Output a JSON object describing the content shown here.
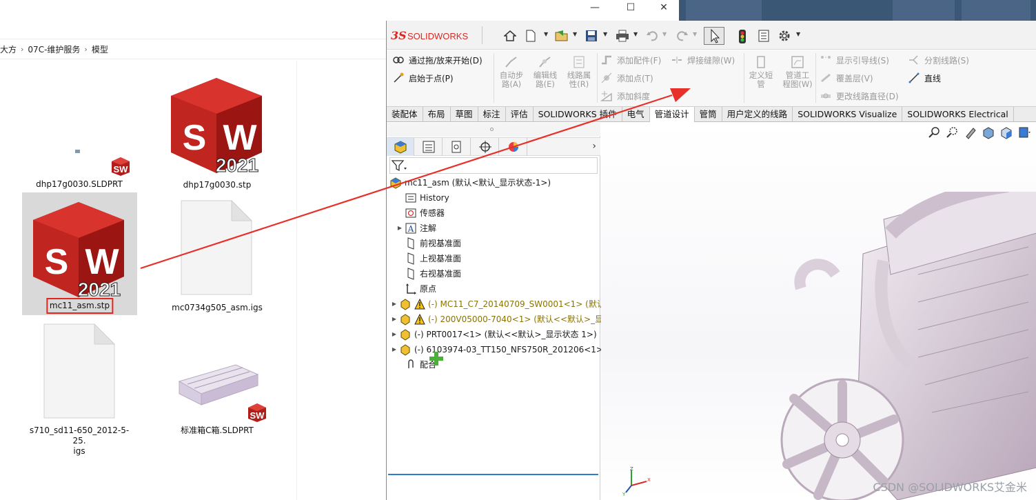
{
  "explorer": {
    "window_buttons": [
      "—",
      "☐",
      "✕"
    ],
    "breadcrumb": [
      "大方",
      "07C-维护服务",
      "模型"
    ],
    "files": [
      {
        "name": "dhp17g0030.SLDPRT"
      },
      {
        "name": "dhp17g0030.stp"
      },
      {
        "name": "mc11_asm.stp"
      },
      {
        "name": "mc0734g505_asm.igs"
      },
      {
        "name": "s710_sd11-650_2012-5-25.\nigs"
      },
      {
        "name": "标准箱C箱.SLDPRT"
      }
    ],
    "sw_icon_year": "2021",
    "sw_icon_letters": "SW"
  },
  "solidworks": {
    "logo_ds": "3S",
    "logo_solid": "SOLID",
    "logo_works": "WORKS",
    "command_manager": {
      "start_drag": "通过拖/放来开始(D)",
      "start_point": "启始于点(P)",
      "auto_route": "自动步\n路(A)",
      "edit_route": "编辑线\n路(E)",
      "route_props": "线路属\n性(R)",
      "add_fitting": "添加配件(F)",
      "add_point": "添加点(T)",
      "add_slope": "添加斜度",
      "weld_gap": "焊接缝隙(W)",
      "define_stub": "定义短\n管",
      "pipe_drawing": "管道工\n程图(W)",
      "show_guides": "显示引导线(S)",
      "cover_layer": "覆盖层(V)",
      "change_diameter": "更改线路直径(D)",
      "split_route": "分割线路(S)",
      "line": "直线"
    },
    "tabs": [
      "装配体",
      "布局",
      "草图",
      "标注",
      "评估",
      "SOLIDWORKS 插件",
      "电气",
      "管道设计",
      "管筒",
      "用户定义的线路",
      "SOLIDWORKS Visualize",
      "SOLIDWORKS Electrical"
    ],
    "active_tab_index": 7,
    "tree": {
      "root": "mc11_asm  (默认<默认_显示状态-1>)",
      "items": [
        {
          "label": "History",
          "warn": false
        },
        {
          "label": "传感器",
          "warn": false
        },
        {
          "label": "注解",
          "warn": false
        },
        {
          "label": "前视基准面",
          "warn": false
        },
        {
          "label": "上视基准面",
          "warn": false
        },
        {
          "label": "右视基准面",
          "warn": false
        },
        {
          "label": "原点",
          "warn": false
        },
        {
          "label": "(-) MC11_C7_20140709_SW0001<1> (默认",
          "warn": true
        },
        {
          "label": "(-) 200V05000-7040<1> (默认<<默认>_显",
          "warn": true
        },
        {
          "label": "(-) PRT0017<1> (默认<<默认>_显示状态 1>)",
          "warn": false
        },
        {
          "label": "(-) 6103974-03_TT150_NFS750R_201206<1>",
          "warn": false
        },
        {
          "label": "配合",
          "warn": false
        }
      ]
    },
    "triad_labels": {
      "x": "X",
      "y": "Y",
      "z": "Z"
    },
    "watermark": "CSDN @SOLIDWORKS艾金米"
  },
  "colors": {
    "sw_red": "#d62a24",
    "highlight_box": "#e0261e",
    "arrow": "#e8302a",
    "model_tint": "#cbbccb"
  }
}
